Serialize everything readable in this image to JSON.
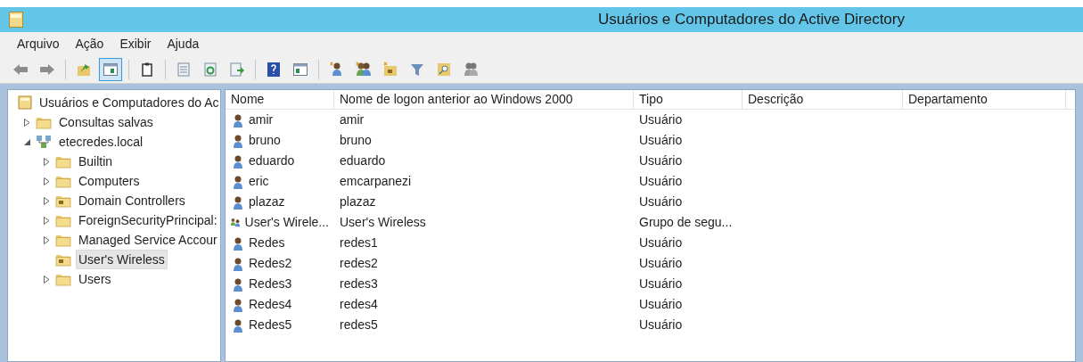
{
  "window": {
    "title": "Usuários e Computadores do Active Directory"
  },
  "menu": [
    "Arquivo",
    "Ação",
    "Exibir",
    "Ajuda"
  ],
  "toolbar": [
    {
      "kind": "back",
      "selected": false
    },
    {
      "kind": "forward",
      "selected": false
    },
    {
      "kind": "separator"
    },
    {
      "kind": "up",
      "selected": false
    },
    {
      "kind": "tree",
      "selected": true
    },
    {
      "kind": "separator"
    },
    {
      "kind": "clipboard",
      "selected": false
    },
    {
      "kind": "separator"
    },
    {
      "kind": "properties",
      "selected": false
    },
    {
      "kind": "refresh",
      "selected": false
    },
    {
      "kind": "export",
      "selected": false
    },
    {
      "kind": "separator"
    },
    {
      "kind": "help",
      "selected": false
    },
    {
      "kind": "panel",
      "selected": false
    },
    {
      "kind": "separator"
    },
    {
      "kind": "new-user",
      "selected": false
    },
    {
      "kind": "new-group",
      "selected": false
    },
    {
      "kind": "new-ou",
      "selected": false
    },
    {
      "kind": "filter",
      "selected": false
    },
    {
      "kind": "find",
      "selected": false
    },
    {
      "kind": "delegate",
      "selected": false
    }
  ],
  "tree": [
    {
      "label": "Usuários e Computadores do Ac",
      "kind": "root",
      "selected": false,
      "children": [
        {
          "label": "Consultas salvas",
          "kind": "folder",
          "expanded": false,
          "selected": false
        },
        {
          "label": "etecredes.local",
          "kind": "domain",
          "expanded": true,
          "selected": false,
          "children": [
            {
              "label": "Builtin",
              "kind": "folder",
              "expanded": false,
              "selected": false
            },
            {
              "label": "Computers",
              "kind": "folder",
              "expanded": false,
              "selected": false
            },
            {
              "label": "Domain Controllers",
              "kind": "ou",
              "expanded": false,
              "selected": false
            },
            {
              "label": "ForeignSecurityPrincipal:",
              "kind": "folder",
              "expanded": false,
              "selected": false
            },
            {
              "label": "Managed Service Accour",
              "kind": "folder",
              "expanded": false,
              "selected": false
            },
            {
              "label": "User's Wireless",
              "kind": "ou",
              "selected": true
            },
            {
              "label": "Users",
              "kind": "folder",
              "expanded": false,
              "selected": false
            }
          ]
        }
      ]
    }
  ],
  "table": {
    "columns": [
      "Nome",
      "Nome de logon anterior ao Windows 2000",
      "Tipo",
      "Descrição",
      "Departamento"
    ],
    "rows": [
      {
        "kind": "user",
        "cells": [
          "amir",
          "amir",
          "Usuário"
        ]
      },
      {
        "kind": "user",
        "cells": [
          "bruno",
          "bruno",
          "Usuário"
        ]
      },
      {
        "kind": "user",
        "cells": [
          "eduardo",
          "eduardo",
          "Usuário"
        ]
      },
      {
        "kind": "user",
        "cells": [
          "eric",
          "emcarpanezi",
          "Usuário"
        ]
      },
      {
        "kind": "user",
        "cells": [
          "plazaz",
          "plazaz",
          "Usuário"
        ]
      },
      {
        "kind": "group",
        "cells": [
          "User's Wirele...",
          "User's Wireless",
          "Grupo de segu..."
        ]
      },
      {
        "kind": "user",
        "cells": [
          "Redes",
          "redes1",
          "Usuário"
        ]
      },
      {
        "kind": "user",
        "cells": [
          "Redes2",
          "redes2",
          "Usuário"
        ]
      },
      {
        "kind": "user",
        "cells": [
          "Redes3",
          "redes3",
          "Usuário"
        ]
      },
      {
        "kind": "user",
        "cells": [
          "Redes4",
          "redes4",
          "Usuário"
        ]
      },
      {
        "kind": "user",
        "cells": [
          "Redes5",
          "redes5",
          "Usuário"
        ]
      }
    ]
  }
}
